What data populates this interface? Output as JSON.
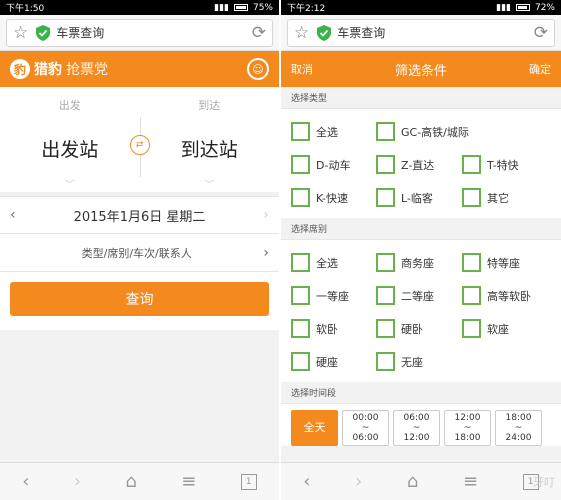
{
  "left": {
    "status": {
      "time": "下午1:50",
      "battery": "75%",
      "battery_level": 0.75
    },
    "url": {
      "title": "车票查询"
    },
    "app": {
      "logo_mark": "豹",
      "logo_text": "猎豹",
      "logo_sub": "抢票党",
      "user_icon": "☺"
    },
    "stations": {
      "depart_label": "出发",
      "depart_value": "出发站",
      "arrive_label": "到达",
      "arrive_value": "到达站",
      "swap_glyph": "⇄"
    },
    "date": {
      "prev": "‹",
      "value": "2015年1月6日 星期二",
      "next": "›"
    },
    "options": {
      "text": "类型/席别/车次/联系人",
      "arrow": "›"
    },
    "query_label": "查询"
  },
  "right": {
    "status": {
      "time": "下午2:12",
      "battery": "72%",
      "battery_level": 0.72
    },
    "url": {
      "title": "车票查询"
    },
    "filter": {
      "cancel": "取消",
      "title": "筛选条件",
      "confirm": "确定"
    },
    "type_section": {
      "title": "选择类型",
      "items": [
        "全选",
        "GC-高铁/城际",
        "D-动车",
        "Z-直达",
        "T-特快",
        "K-快速",
        "L-临客",
        "其它"
      ]
    },
    "seat_section": {
      "title": "选择席别",
      "items": [
        "全选",
        "商务座",
        "特等座",
        "一等座",
        "二等座",
        "高等软卧",
        "软卧",
        "硬卧",
        "软座",
        "硬座",
        "无座"
      ]
    },
    "time_section": {
      "title": "选择时间段",
      "all": "全天",
      "slots": [
        {
          "from": "00:00",
          "sep": "~",
          "to": "06:00"
        },
        {
          "from": "06:00",
          "sep": "~",
          "to": "12:00"
        },
        {
          "from": "12:00",
          "sep": "~",
          "to": "18:00"
        },
        {
          "from": "18:00",
          "sep": "~",
          "to": "24:00"
        }
      ]
    },
    "watermark": "牙叮"
  },
  "bottom": {
    "back": "‹",
    "forward": "›",
    "home": "⌂",
    "menu": "≡",
    "tabs_count": "1"
  },
  "colors": {
    "accent": "#f48a1e",
    "checkbox": "#6ab04c",
    "shield": "#3cb34a"
  }
}
